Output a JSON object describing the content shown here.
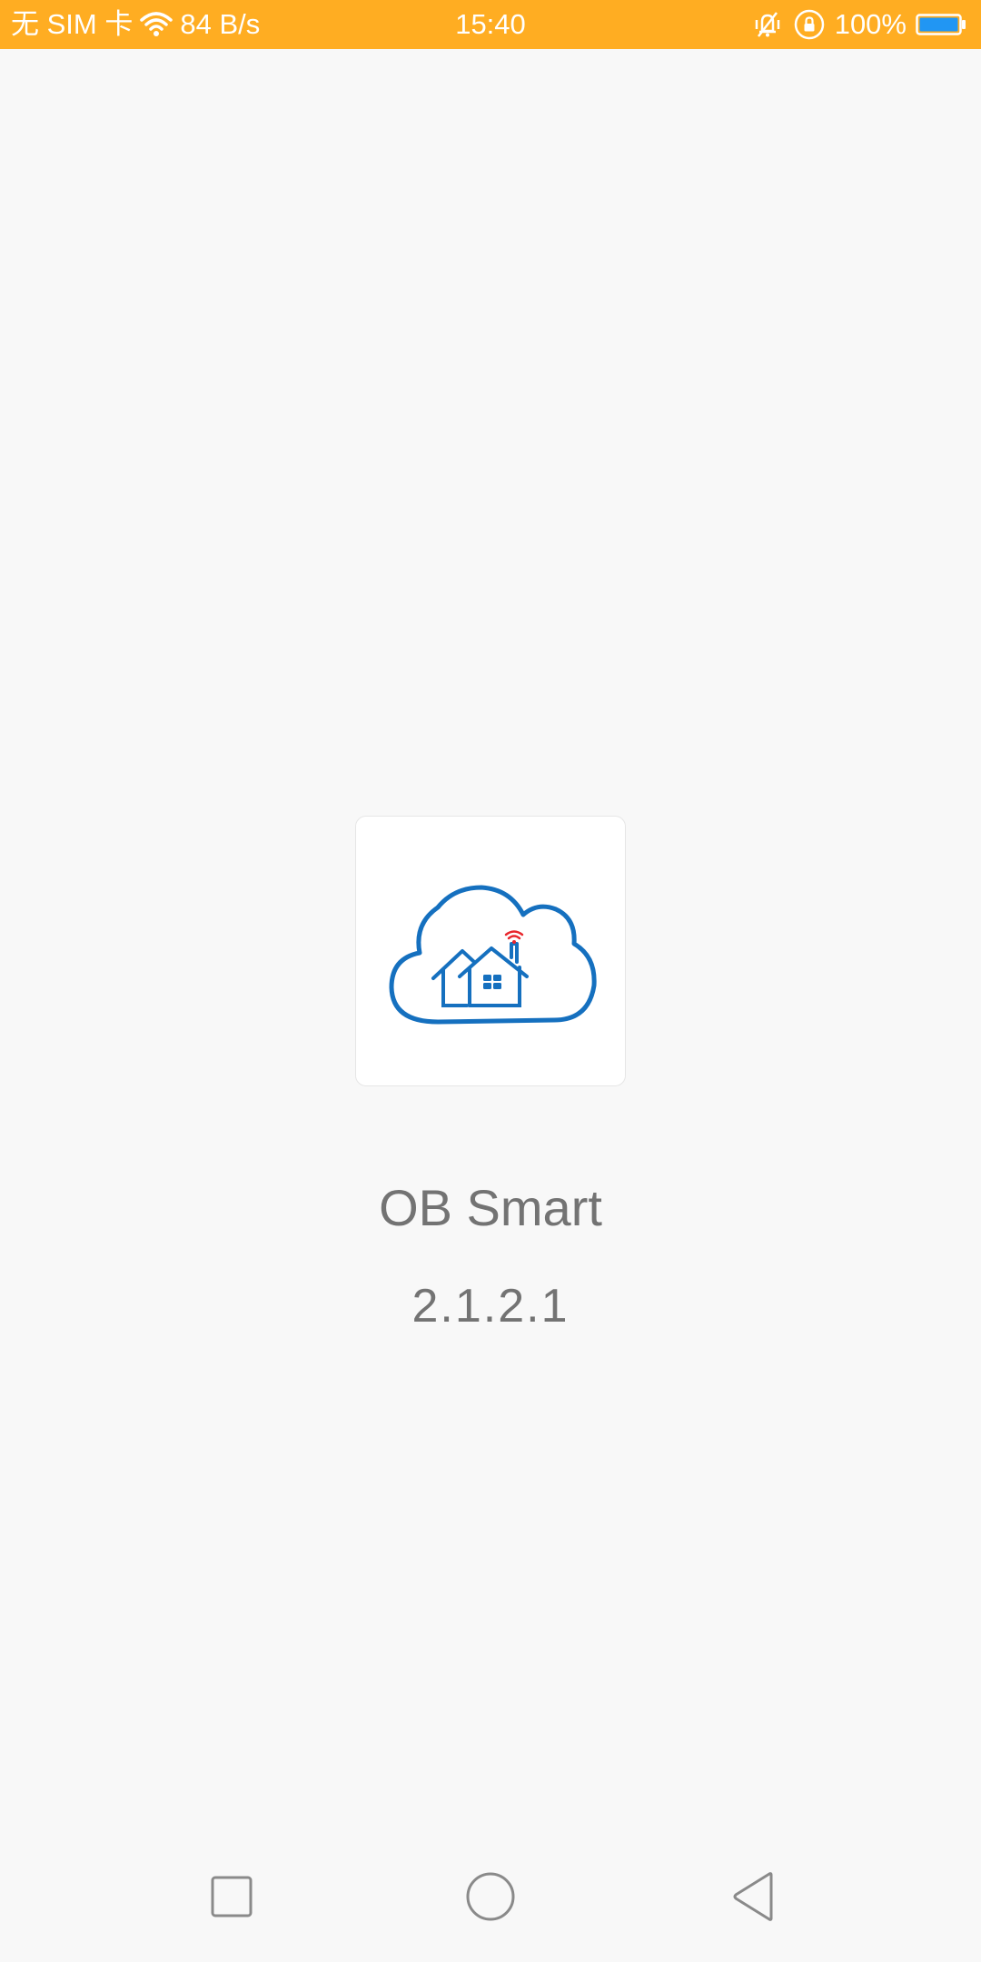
{
  "status_bar": {
    "carrier": "无 SIM 卡",
    "net_speed": "84 B/s",
    "time": "15:40",
    "battery_percent": "100%",
    "battery_level": 1.0,
    "background_color": "#ffad22",
    "icons": [
      "wifi-icon",
      "vibrate-icon",
      "rotation-lock-icon",
      "battery-icon"
    ]
  },
  "splash": {
    "app_name": "OB Smart",
    "version": "2.1.2.1",
    "logo": "cloud-home-logo",
    "logo_color": "#1570bf",
    "wifi_accent_color": "#e8262c"
  },
  "nav_bar": {
    "buttons": [
      "recent-apps",
      "home",
      "back"
    ]
  }
}
